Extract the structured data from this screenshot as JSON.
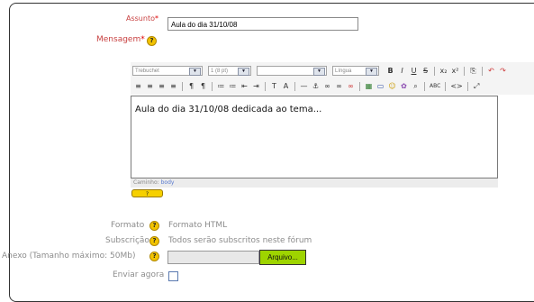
{
  "form": {
    "subject": {
      "label": "Assunto",
      "required_mark": "*",
      "value": "Aula do dia 31/10/08"
    },
    "message": {
      "label": "Mensagem",
      "required_mark": "*",
      "help_icon": "help-icon"
    },
    "toolbar": {
      "font_family": "Trebuchet",
      "font_size": "1 (8 pt)",
      "style_select": "",
      "language": "Língua",
      "row1_buttons": [
        "B",
        "I",
        "U",
        "S",
        "x₂",
        "x²",
        "⎘",
        "↶",
        "↷"
      ],
      "row2_buttons": [
        "≡",
        "≡",
        "≡",
        "≡",
        "¶",
        "¶",
        "≔",
        "≔",
        "⇤",
        "⇥",
        "T",
        "A",
        "—",
        "⚓",
        "∞",
        "∞",
        "∞",
        "▦",
        "▭",
        "☺",
        "✿",
        "⌕",
        "ABC",
        "<>",
        "⤢"
      ]
    },
    "editor_content": "Aula do dia 31/10/08 dedicada ao tema...",
    "path": {
      "label": "Caminho:",
      "value": "body"
    },
    "help_button": "?",
    "format": {
      "label": "Formato",
      "value": "Formato HTML"
    },
    "subscription": {
      "label": "Subscrição",
      "value": "Todos serão subscritos neste fórum"
    },
    "attachment": {
      "label": "Anexo (Tamanho máximo: 50Mb)",
      "button": "Arquivo..."
    },
    "send_now": {
      "label": "Enviar agora",
      "checked": false
    }
  }
}
